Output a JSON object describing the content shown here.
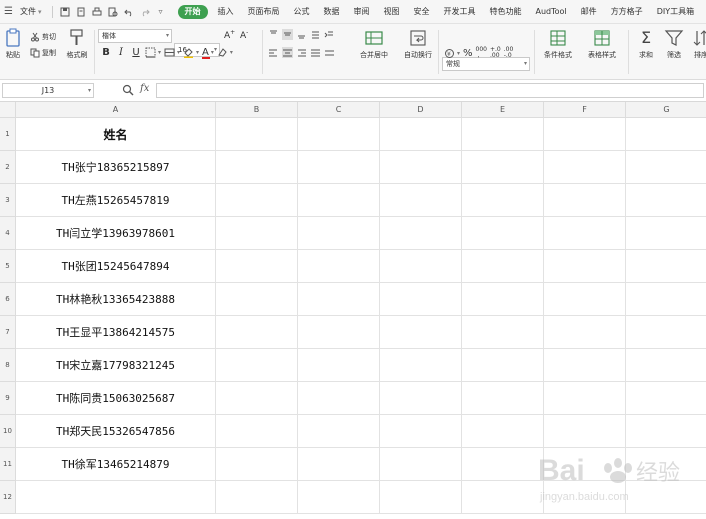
{
  "menubar": {
    "file_label": "文件",
    "tabs": [
      {
        "label": "开始",
        "active": true
      },
      {
        "label": "插入"
      },
      {
        "label": "页面布局"
      },
      {
        "label": "公式"
      },
      {
        "label": "数据"
      },
      {
        "label": "审阅"
      },
      {
        "label": "视图"
      },
      {
        "label": "安全"
      },
      {
        "label": "开发工具"
      },
      {
        "label": "特色功能"
      },
      {
        "label": "AudTool"
      },
      {
        "label": "邮件"
      },
      {
        "label": "方方格子"
      },
      {
        "label": "DIY工具箱"
      }
    ]
  },
  "ribbon": {
    "paste_label": "粘贴",
    "cut_label": "剪切",
    "copy_label": "复制",
    "format_painter_label": "格式刷",
    "font_name": "楷体",
    "font_size": "16",
    "merge_center_label": "合并居中",
    "wrap_text_label": "自动换行",
    "number_format": "常规",
    "cond_format_label": "条件格式",
    "table_style_label": "表格样式",
    "sum_label": "求和",
    "filter_label": "筛选",
    "sort_label": "排序",
    "accent_color": "#3ea050"
  },
  "formula_bar": {
    "name_box": "J13",
    "fx_label": "fx",
    "formula": ""
  },
  "sheet": {
    "columns": [
      "A",
      "B",
      "C",
      "D",
      "E",
      "F",
      "G"
    ],
    "rows": [
      "1",
      "2",
      "3",
      "4",
      "5",
      "6",
      "7",
      "8",
      "9",
      "10",
      "11",
      "12"
    ],
    "colA": [
      "姓名",
      "TH张宁18365215897",
      "TH左燕15265457819",
      "TH闫立学13963978601",
      "TH张团15245647894",
      "TH林艳秋13365423888",
      "TH王显平13864214575",
      "TH宋立嘉17798321245",
      "TH陈同贵15063025687",
      "TH郑天民15326547856",
      "TH徐军13465214879",
      ""
    ]
  },
  "watermark": {
    "brand": "Bai",
    "brand2": "经验",
    "url": "jingyan.baidu.com"
  }
}
